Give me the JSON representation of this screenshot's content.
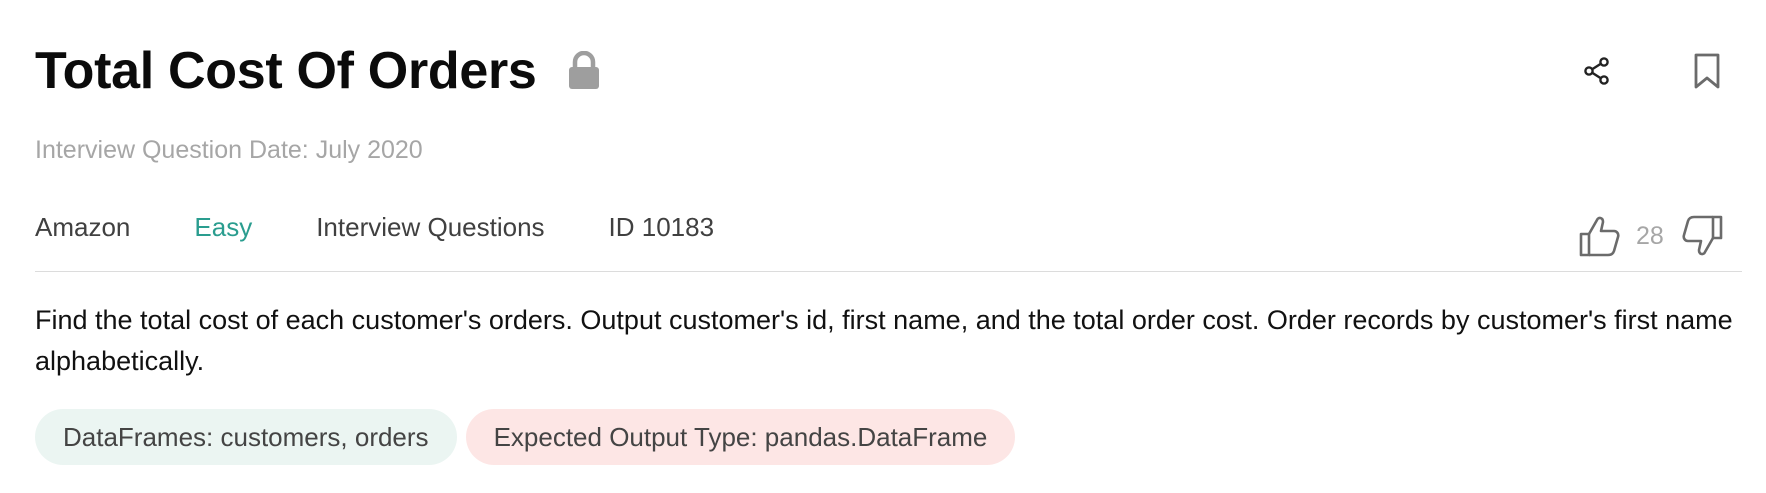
{
  "header": {
    "title": "Total Cost Of Orders",
    "date_text": "Interview Question Date: July 2020"
  },
  "meta": {
    "company": "Amazon",
    "difficulty": "Easy",
    "category": "Interview Questions",
    "id_text": "ID 10183"
  },
  "votes": {
    "count": "28"
  },
  "question": {
    "description": "Find the total cost of each customer's orders. Output customer's id, first name, and the total order cost. Order records by customer's first name alphabetically."
  },
  "chips": {
    "dataframes": "DataFrames: customers, orders",
    "output_type": "Expected Output Type: pandas.DataFrame"
  },
  "colors": {
    "difficulty_easy": "#2a9d8f",
    "chip_dataframes_bg": "#ebf5f2",
    "chip_output_bg": "#fde6e5",
    "muted_text": "#a6a6a6",
    "icon_gray": "#9e9e9e"
  },
  "icons": {
    "lock": "lock-icon",
    "share": "share-icon",
    "bookmark": "bookmark-icon",
    "thumbs_up": "thumbs-up-icon",
    "thumbs_down": "thumbs-down-icon"
  }
}
